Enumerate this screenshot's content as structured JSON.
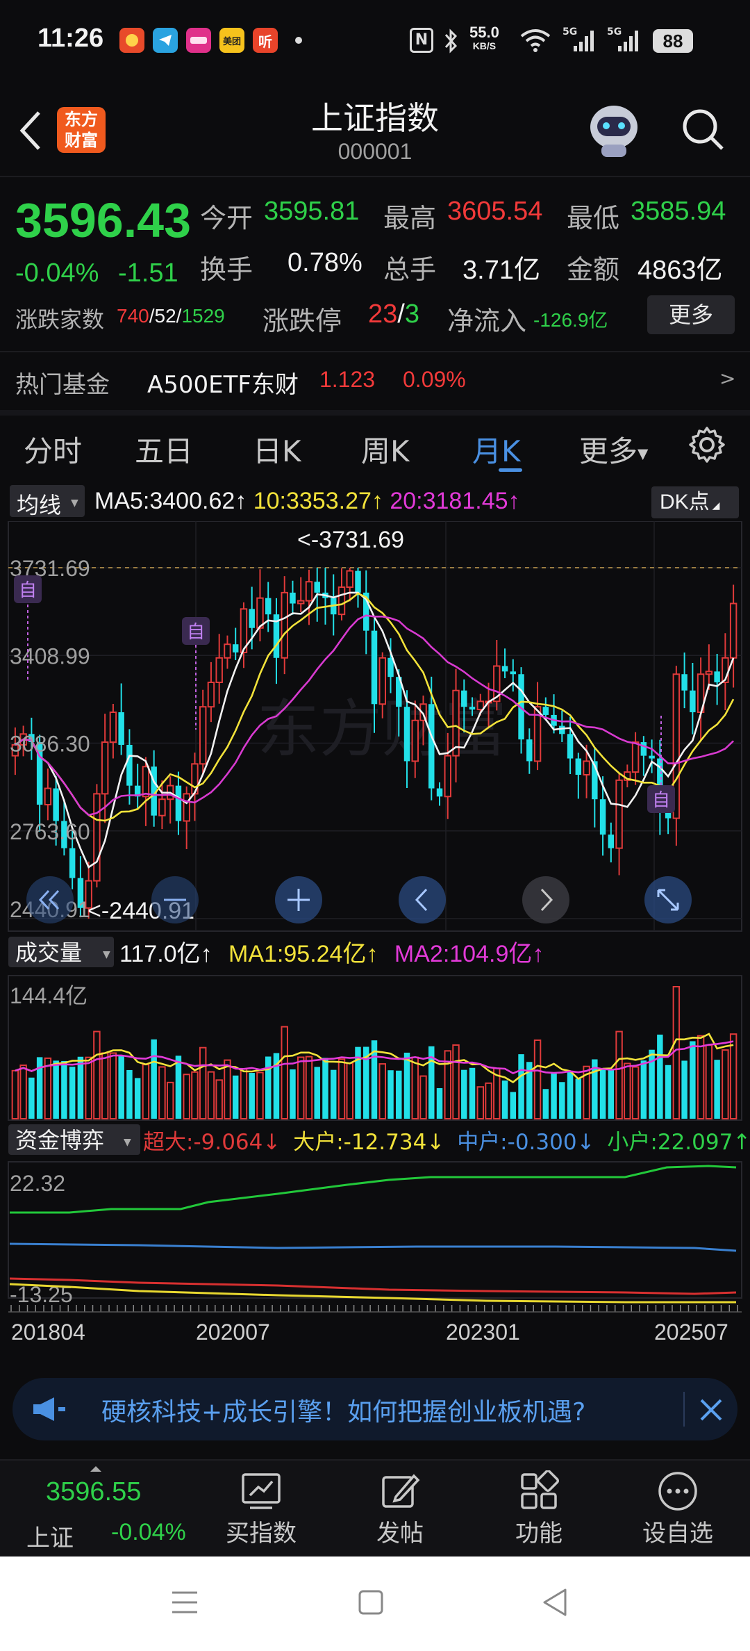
{
  "status_bar": {
    "time": "11:26",
    "speed_value": "55.0",
    "speed_unit": "KB/S",
    "net1": "5G",
    "net2": "5G",
    "battery": "88",
    "app_icons": [
      {
        "name": "app-icon-1",
        "color": "#e84a2a",
        "text": ""
      },
      {
        "name": "telegram-icon",
        "color": "#2aa3e0",
        "text": ""
      },
      {
        "name": "app-icon-3",
        "color": "#e0308a",
        "text": ""
      },
      {
        "name": "meituan-icon",
        "color": "#f6c21c",
        "text": "美团"
      },
      {
        "name": "app-icon-5",
        "color": "#e8442a",
        "text": "听"
      }
    ]
  },
  "header": {
    "logo_line1": "东方",
    "logo_line2": "财富",
    "title": "上证指数",
    "code": "000001"
  },
  "quote": {
    "price": "3596.43",
    "change_pct": "-0.04%",
    "change": "-1.51",
    "open_label": "今开",
    "open_value": "3595.81",
    "high_label": "最高",
    "high_value": "3605.54",
    "low_label": "最低",
    "low_value": "3585.94",
    "turnover_label": "换手",
    "turnover_value": "0.78%",
    "volume_label": "总手",
    "volume_value": "3.71亿",
    "amount_label": "金额",
    "amount_value": "4863亿",
    "breadth_label": "涨跌家数",
    "breadth_up": "740",
    "breadth_flat": "52",
    "breadth_down": "1529",
    "slash": "/",
    "limit_label": "涨跌停",
    "limit_up": "23",
    "limit_down": "3",
    "inflow_label": "净流入",
    "inflow_value": "-126.9亿",
    "more_button": "更多"
  },
  "hot_fund": {
    "label": "热门基金",
    "name": "A500ETF东财",
    "price": "1.123",
    "change": "0.09%",
    "arrow": ">"
  },
  "tabs": [
    {
      "label": "分时",
      "active": false
    },
    {
      "label": "五日",
      "active": false
    },
    {
      "label": "日K",
      "active": false
    },
    {
      "label": "周K",
      "active": false
    },
    {
      "label": "月K",
      "active": true
    },
    {
      "label": "更多",
      "active": false
    }
  ],
  "legend": {
    "indicator": "均线",
    "ma5": "MA5:3400.62",
    "ma10": "10:3353.27",
    "ma20": "20:3181.45",
    "arrow_up": "↑",
    "dk_button": "DK点"
  },
  "kline_axis": {
    "y_ticks": [
      "3731.69",
      "3408.99",
      "3086.30",
      "2763.60",
      "2440.91"
    ],
    "max_label": "<-3731.69",
    "min_label": "<-2440.91",
    "marker": "自"
  },
  "volume_legend": {
    "indicator": "成交量",
    "vol": "117.0亿",
    "ma1": "MA1:95.24亿",
    "ma2": "MA2:104.9亿",
    "arrow_up": "↑",
    "max_tick": "144.4亿"
  },
  "fund_legend": {
    "indicator": "资金博弈",
    "super": "超大:-9.064",
    "large": "大户:-12.734",
    "medium": "中户:-0.300",
    "small": "小户:22.097",
    "arrow_down": "↓",
    "arrow_up": "↑",
    "top_tick": "22.32",
    "bottom_tick": "-13.25"
  },
  "x_axis": [
    "201804",
    "202007",
    "202301",
    "202507"
  ],
  "colors": {
    "up": "#e03a3a",
    "down": "#22e0e8",
    "ma5": "#f2f2f2",
    "ma10": "#f2e23a",
    "ma20": "#d83ad0",
    "accent": "#4a90e2"
  },
  "banner": {
    "text": "硬核科技+成长引擎！如何把握创业板机遇?"
  },
  "bottom_nav": {
    "index_price": "3596.55",
    "index_name": "上证",
    "index_change": "-0.04%",
    "items": [
      "买指数",
      "发帖",
      "功能",
      "设自选"
    ]
  },
  "chart_data": {
    "type": "candlestick",
    "x_labels": [
      "201804",
      "202007",
      "202301",
      "202507"
    ],
    "ylim": [
      2440.91,
      3731.69
    ],
    "y_ticks": [
      3731.69,
      3408.99,
      3086.3,
      2763.6,
      2440.91
    ],
    "max": 3731.69,
    "min": 2440.91,
    "ma": {
      "MA5": 3400.62,
      "MA10": 3353.27,
      "MA20": 3181.45
    },
    "volume": {
      "last": "117.0亿",
      "MA1": "95.24亿",
      "MA2": "104.9亿",
      "max": "144.4亿"
    },
    "fund_flow": {
      "超大": -9.064,
      "大户": -12.734,
      "中户": -0.3,
      "小户": 22.097,
      "ylim": [
        -13.25,
        22.32
      ]
    },
    "close": [
      3080,
      3120,
      3090,
      2860,
      2920,
      2800,
      2700,
      2590,
      2480,
      2580,
      2900,
      3090,
      3200,
      3080,
      2930,
      2890,
      3000,
      2820,
      2880,
      2930,
      2800,
      2900,
      3010,
      3220,
      3310,
      3400,
      3450,
      3420,
      3580,
      3510,
      3620,
      3560,
      3400,
      3640,
      3600,
      3610,
      3680,
      3640,
      3620,
      3560,
      3660,
      3720,
      3640,
      3500,
      3230,
      3400,
      3330,
      3220,
      3020,
      3170,
      3230,
      2920,
      2890,
      3040,
      3280,
      3220,
      3210,
      3240,
      3240,
      3370,
      3350,
      3340,
      3100,
      3020,
      3220,
      3190,
      3150,
      3120,
      3030,
      2970,
      3020,
      2880,
      2750,
      2700,
      2950,
      2980,
      3090,
      3040,
      3030,
      2850,
      2810,
      3340,
      3280,
      3200,
      3340,
      3350,
      3310,
      3400,
      3600
    ]
  }
}
